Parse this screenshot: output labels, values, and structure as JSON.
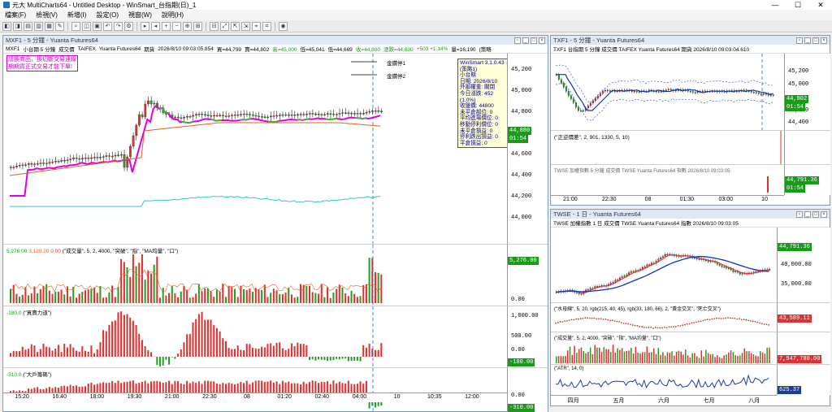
{
  "title": {
    "app": "元大 MultiCharts64 - Untitled Desktop - WinSmart_台指期(日)_1",
    "min": "—",
    "max": "☐",
    "close": "✕"
  },
  "menu": [
    "檔案(F)",
    "檢視(V)",
    "新增(I)",
    "設定(O)",
    "視窗(W)",
    "說明(H)"
  ],
  "colors": {
    "up": "#e03030",
    "down": "#20a020",
    "accent": "#1e6ec8",
    "magenta": "#e000e0",
    "green_line": "#22cc22",
    "orange": "#e06020",
    "cyan": "#30c8c0"
  },
  "main": {
    "title": "MXF1 - 5 分鐘 - Yuanta Futures64",
    "info": {
      "symbol": "MXF1",
      "name": "小台期 5 分鐘",
      "kind": "成交價",
      "exch": "TAIFEX",
      "broker": "Yuanta Futures64",
      "period": "期貨",
      "datetime": "2026/8/10 09:03:05.854",
      "buy": "買=44,799",
      "sell": "賣=44,802",
      "high": "高=45,000",
      "low": "低=45,041",
      "low2": "低=44,669",
      "close": "收=44,800",
      "chg": "漲跌=44,800",
      "chgpct": "+503 +1.14%",
      "vol": "量=16,190",
      "tail": "(策略"
    },
    "notice": [
      "請換商品，換切斷交易連線",
      "期期貨正式交易才能下單!"
    ],
    "gold1": "金鑽停1",
    "gold2": "金鑽停2",
    "infobox": [
      "WinSmart 3.1.0.43",
      "(策略1)",
      "小台期",
      "日期: 2026/8/10",
      "外部權重: 關閉",
      "今日漲跌: 452 (1.0%)",
      "收盤價: 44800",
      "未平倉部位: 0",
      "平均進場價位: 0",
      "移動停利價位: 0",
      "未平倉損益: 0",
      "停利跌出損益: 0",
      "平倉損益: 0"
    ],
    "price_ticks": [
      "45,200",
      "45,000",
      "44,800",
      "44,600",
      "44,400",
      "44,200",
      "44,000"
    ],
    "price_tag": "44,880",
    "time_tag": "01:54",
    "vol_label": "(\"成交量\", 5, 2, 4000, \"突破\", \"指\", \"MA均量\", \"口\")",
    "vol_head": [
      "5,276.00",
      "3,120.20",
      "0.00"
    ],
    "vol_ticks": [
      "0.00"
    ],
    "vol_tag": "5,276.00",
    "bs_label": "(\"買賣力道\")",
    "bs_head": "-180.0",
    "bs_ticks": [
      "1,000.00",
      "500.00",
      "0.00"
    ],
    "bs_tag": "-180.00",
    "big_label": "(\"大戶籌碼\")",
    "big_head": "-310.0",
    "big_ticks": [
      "0.00"
    ],
    "big_tag": "-310.00",
    "time_labels": [
      "15:20",
      "16:40",
      "18:00",
      "19:30",
      "21:00",
      "22:30",
      "08",
      "01:20",
      "02:40",
      "04:00",
      "10",
      "10:35",
      "12:00"
    ]
  },
  "txf": {
    "title": "TXF1 - 5 分鐘 - Yuanta Futures64",
    "info": "TXF1  台指期  5 分鐘  成交價  TAIFEX  Yuanta Futures64  期貨  2026/8/10  09:03:04.610",
    "price_ticks": [
      "45,200",
      "45,000",
      "44,800",
      "44,600",
      "44,400"
    ],
    "price_tag": "44,802",
    "time_tag": "01:54",
    "ind1_label": "(\"正逆價差\", 2, 901, 1330, 5, 10)",
    "twse_info": "TWSE  加權指數  5 分鐘  成交價  TWSE  Yuanta Futures64  指數  2026/8/10  09:03:05",
    "twse_tag": "44,791.36",
    "twse_time": "01:54",
    "time_labels": [
      "21:00",
      "22:30",
      "08",
      "01:30",
      "03:00",
      "10"
    ]
  },
  "daily": {
    "title": "TWSE - 1 日 - Yuanta Futures64",
    "info": "TWSE  加權指數  1 日  成交價  TWSE  Yuanta Futures64  指數  2026/8/10  09:03:05",
    "price_ticks": [
      "45,000.00",
      "40,000.00",
      "35,000.00"
    ],
    "price_tag": "44,791.36",
    "ind1_label": "(\"水母線\", 5, 20, rgb(215, 40, 45), rgb(33, 180, 66), 2, \"黃金交叉\", \"死亡交叉\")",
    "ind1_tag": "43,589.11",
    "ind2_label": "(\"成交量\", 5, 2, 4000, \"突破\", \"指\", \"MA均量\", \"口\")",
    "ind2_tag": "7,947,780.00",
    "ind3_label": "(\"ATR\", 14, 0)",
    "ind3_tag": "625.37",
    "time_labels": [
      "四月",
      "五月",
      "六月",
      "七月",
      "八月"
    ]
  }
}
